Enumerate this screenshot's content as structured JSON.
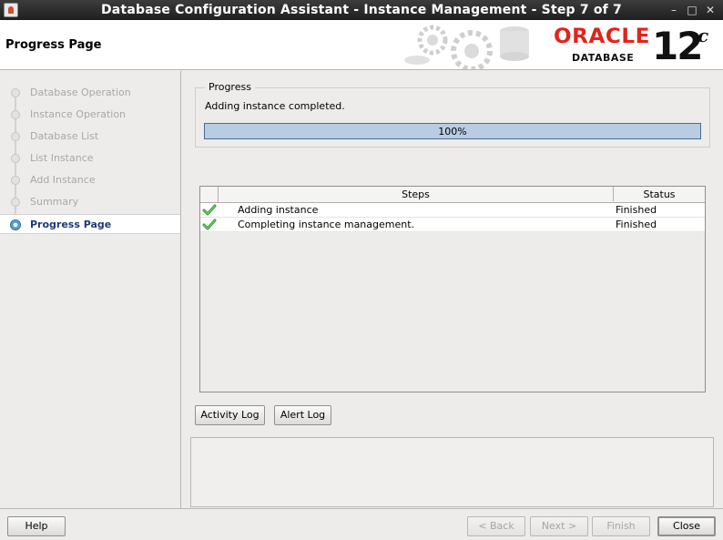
{
  "window": {
    "title": "Database Configuration Assistant - Instance Management - Step 7 of 7",
    "minimize": "–",
    "maximize": "□",
    "close": "✕"
  },
  "header": {
    "page_title": "Progress Page",
    "logo_brand": "ORACLE",
    "logo_product": "DATABASE",
    "logo_version": "12",
    "logo_version_suffix": "c"
  },
  "nav": {
    "items": [
      {
        "label": "Database Operation",
        "state": "done"
      },
      {
        "label": "Instance Operation",
        "state": "done"
      },
      {
        "label": "Database List",
        "state": "done"
      },
      {
        "label": "List Instance",
        "state": "done"
      },
      {
        "label": "Add Instance",
        "state": "done"
      },
      {
        "label": "Summary",
        "state": "done"
      },
      {
        "label": "Progress Page",
        "state": "active"
      }
    ]
  },
  "progress": {
    "legend": "Progress",
    "status_text": "Adding instance completed.",
    "percent_label": "100%",
    "value": 1.0
  },
  "steps_table": {
    "columns": [
      "Steps",
      "Status"
    ],
    "rows": [
      {
        "step": "Adding instance",
        "status": "Finished",
        "icon": "check-icon"
      },
      {
        "step": "Completing instance management.",
        "status": "Finished",
        "icon": "check-icon"
      }
    ]
  },
  "log_buttons": {
    "activity_log": "Activity Log",
    "alert_log": "Alert Log"
  },
  "footer": {
    "help": "Help",
    "back": "< Back",
    "next": "Next >",
    "finish": "Finish",
    "close": "Close"
  },
  "colors": {
    "accent_nav": "#1d3a77",
    "oracle_red": "#e2231a",
    "progress_fill": "#b8cde3",
    "check_green": "#2e9b2e"
  }
}
